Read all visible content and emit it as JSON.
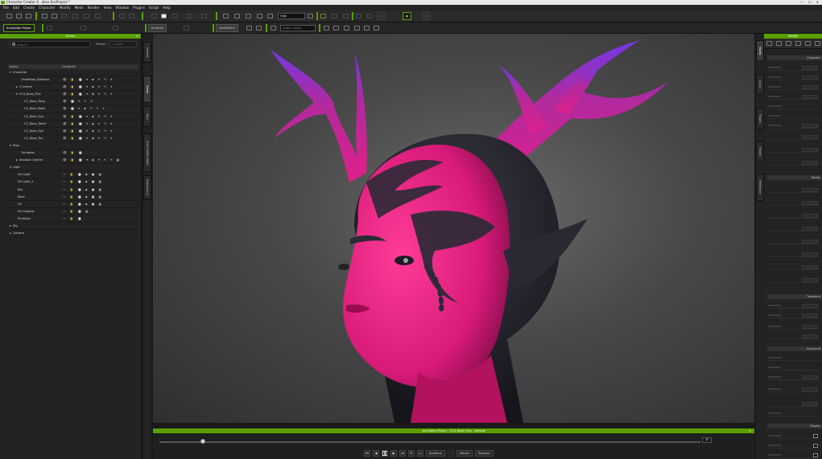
{
  "window": {
    "title": "Character Creator 4 - alien EcoProject *"
  },
  "menu": [
    "File",
    "Edit",
    "Create",
    "Character",
    "Modify",
    "Mesh",
    "Render",
    "View",
    "Window",
    "Plugins",
    "Script",
    "Help"
  ],
  "toolbar": {
    "quality": "High",
    "tabs": [
      "Animation Player",
      "Portal2D",
      "HEADSHOT"
    ],
    "search_placeholder": "Origin: Defau"
  },
  "scene": {
    "title": "Scene",
    "search_placeholder": "Search",
    "preset_label": "Preset :",
    "preset_value": "Custom",
    "columns": [
      "Name",
      "Condition"
    ],
    "rows": [
      {
        "label": "Character",
        "indent": 0,
        "arrow": "▾",
        "icons": ""
      },
      {
        "label": "Undefined_Bottoms",
        "indent": 3,
        "arrow": "",
        "icons": "👁 🔒 ⬤ ▾ ▪ ▾ ✎ ▾"
      },
      {
        "label": "2 hmmm",
        "indent": 2,
        "arrow": "▸",
        "icons": "👁 🔒 ⬤ ▾ ▪ ▾ ✎ ▾"
      },
      {
        "label": "CC3_Base_Plus",
        "indent": 2,
        "arrow": "▾",
        "icons": "👁 🔒 ⬤ ▾ ▪ ▾ ✎ ▾"
      },
      {
        "label": "CC_Base_Tong",
        "indent": 4,
        "arrow": "",
        "icons": "👁 ⬤ ▾ ✎ ▾"
      },
      {
        "label": "CC_Base_Body",
        "indent": 4,
        "arrow": "",
        "icons": "👁 ⬤ ▾ ▪ ▾ ✎ ▾"
      },
      {
        "label": "CC_Base_Eye",
        "indent": 4,
        "arrow": "",
        "icons": "👁 🔒 ⬤ ▾ ▪ ▾ ✎ ▾"
      },
      {
        "label": "CC_Base_Teeth",
        "indent": 4,
        "arrow": "",
        "icons": "👁 🔒 ⬤ ▾ ▪ ▾ ✎ ▾"
      },
      {
        "label": "CC_Base_Eye",
        "indent": 4,
        "arrow": "",
        "icons": "👁 🔒 ⬤ ▾ ▪ ▾ ✎ ▾"
      },
      {
        "label": "CC_Base_Ton",
        "indent": 4,
        "arrow": "",
        "icons": "👁 🔒 ⬤ ▾ ▪ ▾ ✎ ▾"
      },
      {
        "label": "Prop",
        "indent": 0,
        "arrow": "▾",
        "icons": ""
      },
      {
        "label": "Turntable",
        "indent": 3,
        "arrow": "",
        "icons": "👁 🔒 ⬤"
      },
      {
        "label": "Shadow Catcher",
        "indent": 2,
        "arrow": "▸",
        "icons": "👁 🔒 ⬤ ▾ ▪ ▾ ✎ ▾ ▦"
      },
      {
        "label": "Light",
        "indent": 0,
        "arrow": "▾",
        "icons": ""
      },
      {
        "label": "Dir Light",
        "indent": 2,
        "arrow": "",
        "icons": "〰 🔒 ⬤ ▪ ■ ▦"
      },
      {
        "label": "Dir Light_1",
        "indent": 2,
        "arrow": "",
        "icons": "〰 🔒 ⬤ ▪ ■ ▦"
      },
      {
        "label": "Key",
        "indent": 2,
        "arrow": "",
        "icons": "〰 🔒 ⬤ ▪ ■ ▦"
      },
      {
        "label": "Back",
        "indent": 2,
        "arrow": "",
        "icons": "〰 🔒 ⬤ ▪ ■ ▦"
      },
      {
        "label": "Fill",
        "indent": 2,
        "arrow": "",
        "icons": "〰 🔒 ⬤ ▪ ■ ▦"
      },
      {
        "label": "Dir Shadow",
        "indent": 2,
        "arrow": "",
        "icons": "〰 🔒 ⬤ ▦"
      },
      {
        "label": "Emissive",
        "indent": 2,
        "arrow": "",
        "icons": "〰 🔒 ⬤"
      },
      {
        "label": "Sky",
        "indent": 0,
        "arrow": "▸",
        "icons": ""
      },
      {
        "label": "Camera",
        "indent": 0,
        "arrow": "▸",
        "icons": ""
      }
    ]
  },
  "left_tabs": [
    "Content",
    "Scene",
    "Story",
    "Facial Profile Editor",
    "Headshot v2"
  ],
  "right_tabs": [
    "Modify",
    "Visual",
    "Project",
    "Render",
    "Preference"
  ],
  "viewport": {
    "skin_color": "#e8207e",
    "dark_color": "#2b2a36",
    "horn_color": "#c6238c",
    "horn_tip": "#7a3de0"
  },
  "animation_player": {
    "title": "Animation Player : CC3_Base_Plus - Default",
    "frame": "30",
    "realtime_label": "Realtime",
    "motion_label": "Motion",
    "reverse_label": "Reverse",
    "progress": 0.08
  },
  "modify": {
    "title": "Modify",
    "sections": [
      "Character",
      "Modify",
      "Transform",
      "Smooth M",
      "Display"
    ]
  }
}
